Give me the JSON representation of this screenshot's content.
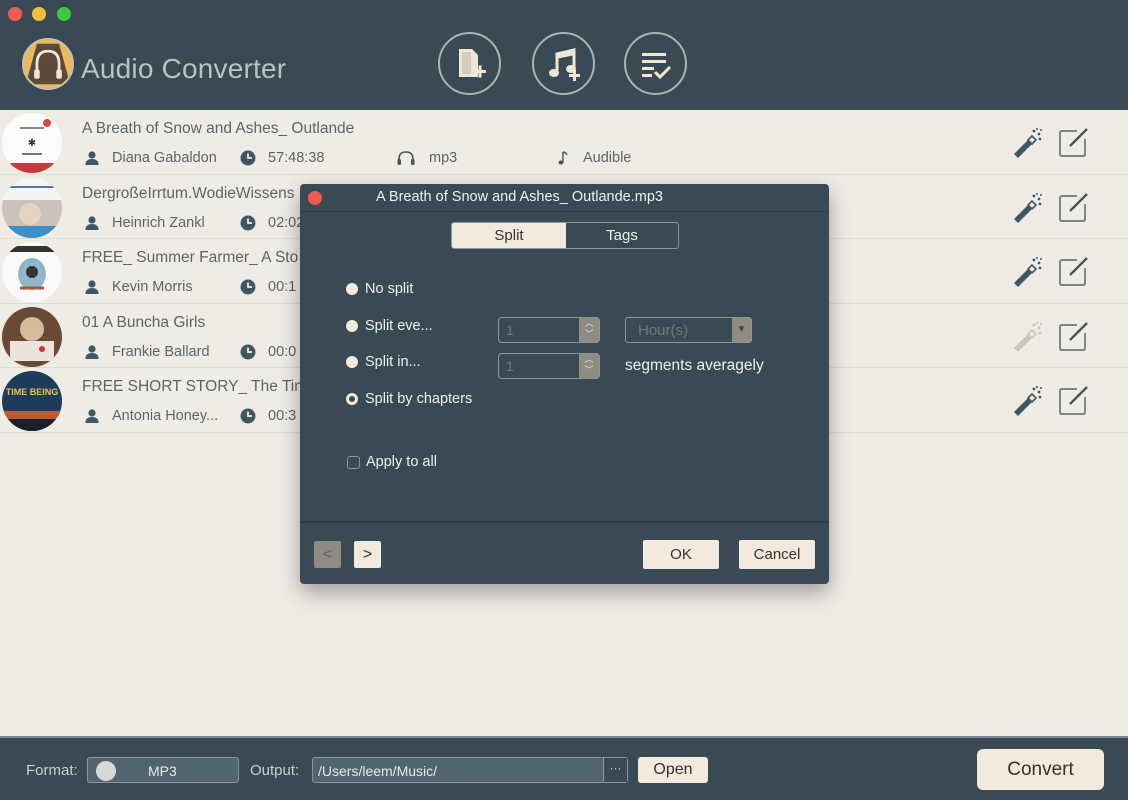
{
  "window": {
    "title": "Audio Converter"
  },
  "toolbar": {
    "buttons": [
      {
        "icon": "add-file-icon",
        "label": "Add File"
      },
      {
        "icon": "add-music-icon",
        "label": "Add Music"
      },
      {
        "icon": "convert-list-icon",
        "label": "Task List"
      }
    ]
  },
  "files": [
    {
      "title": "A Breath of Snow and Ashes_ Outlande",
      "author": "Diana Gabaldon",
      "duration": "57:48:38",
      "format": "mp3",
      "source": "Audible",
      "art": "snow-cover"
    },
    {
      "title": "DergroßeIrrtum.WodieWissens",
      "author": "Heinrich Zankl",
      "duration": "02:02",
      "format": "",
      "source": "",
      "art": "irrtum-cover"
    },
    {
      "title": "FREE_ Summer Farmer_ A Sto",
      "author": "Kevin Morris",
      "duration": "00:1",
      "format": "",
      "source": "",
      "art": "farmer-cover"
    },
    {
      "title": "01 A Buncha Girls",
      "author": "Frankie Ballard",
      "duration": "00:0",
      "format": "",
      "source": "",
      "art": "buncha-cover",
      "effects_disabled": true
    },
    {
      "title": "FREE SHORT STORY_ The Tim",
      "author": "Antonia Honey...",
      "duration": "00:3",
      "format": "",
      "source": "",
      "art": "timebeing-cover"
    }
  ],
  "dialog": {
    "title": "A Breath of Snow and Ashes_ Outlande.mp3",
    "tabs": [
      {
        "label": "Split",
        "active": true
      },
      {
        "label": "Tags",
        "active": false
      }
    ],
    "options": [
      {
        "label": "No split",
        "selected": false
      },
      {
        "label": "Split eve...",
        "selected": false
      },
      {
        "label": "Split in...",
        "selected": false
      },
      {
        "label": "Split by chapters",
        "selected": true
      }
    ],
    "split_every_value": "1",
    "split_every_unit": "Hour(s)",
    "split_in_value": "1",
    "segments_label": "segments averagely",
    "apply_to_all_label": "Apply to all",
    "apply_to_all_checked": false,
    "prev_label": "<",
    "next_label": ">",
    "ok_label": "OK",
    "cancel_label": "Cancel"
  },
  "bottom": {
    "format_label": "Format:",
    "format_value": "MP3",
    "output_label": "Output:",
    "output_path": "/Users/leem/Music/",
    "browse_label": "···",
    "open_label": "Open",
    "convert_label": "Convert"
  },
  "colors": {
    "header_bg": "#3a4a54",
    "list_bg": "#efece6",
    "button_bg": "#f3e9dc",
    "accent_icon": "#3f5763"
  }
}
